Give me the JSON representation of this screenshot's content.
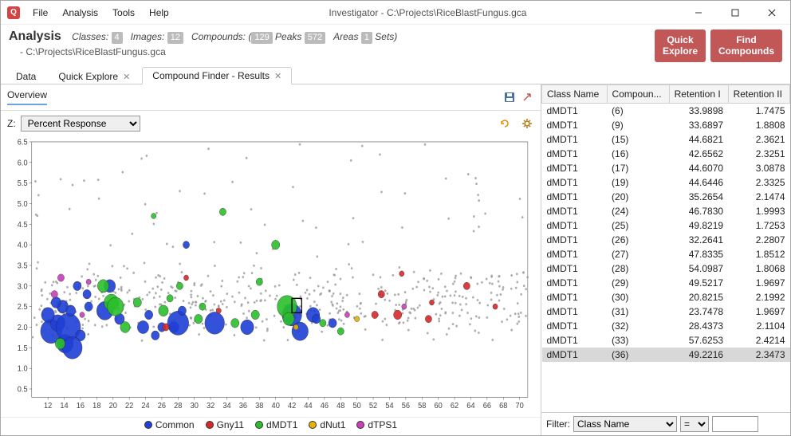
{
  "window": {
    "title": "Investigator - C:\\Projects\\RiceBlastFungus.gca"
  },
  "menu": {
    "items": [
      "File",
      "Analysis",
      "Tools",
      "Help"
    ]
  },
  "analysis": {
    "label": "Analysis",
    "stats": {
      "classes_label": "Classes:",
      "classes": "4",
      "images_label": "Images:",
      "images": "12",
      "compounds_label": "Compounds: (",
      "compounds": "129",
      "peaks_label": "Peaks",
      "peaks": "572",
      "areas_label": "Areas",
      "areas": "1",
      "sets_label": "Sets)"
    },
    "path": "- C:\\Projects\\RiceBlastFungus.gca"
  },
  "header_buttons": {
    "quick_explore": "Quick\nExplore",
    "find_compounds": "Find\nCompounds"
  },
  "tabs": {
    "data": "Data",
    "quick_explore": "Quick Explore",
    "compound_finder": "Compound Finder - Results"
  },
  "overview": {
    "title": "Overview"
  },
  "z_selector": {
    "label": "Z:",
    "options": [
      "Percent Response"
    ],
    "selected": "Percent Response"
  },
  "legend": {
    "entries": [
      {
        "name": "Common",
        "color": "#1f3fd6"
      },
      {
        "name": "Gny11",
        "color": "#d62a2a"
      },
      {
        "name": "dMDT1",
        "color": "#2bbf2b"
      },
      {
        "name": "dNut1",
        "color": "#e8b000"
      },
      {
        "name": "dTPS1",
        "color": "#c83fb8"
      }
    ]
  },
  "table": {
    "headers": [
      "Class Name",
      "Compoun...",
      "Retention I",
      "Retention II"
    ],
    "rows": [
      [
        "dMDT1",
        "(6)",
        "33.9898",
        "1.7475"
      ],
      [
        "dMDT1",
        "(9)",
        "33.6897",
        "1.8808"
      ],
      [
        "dMDT1",
        "(15)",
        "44.6821",
        "2.3621"
      ],
      [
        "dMDT1",
        "(16)",
        "42.6562",
        "2.3251"
      ],
      [
        "dMDT1",
        "(17)",
        "44.6070",
        "3.0878"
      ],
      [
        "dMDT1",
        "(19)",
        "44.6446",
        "2.3325"
      ],
      [
        "dMDT1",
        "(20)",
        "35.2654",
        "2.1474"
      ],
      [
        "dMDT1",
        "(24)",
        "46.7830",
        "1.9993"
      ],
      [
        "dMDT1",
        "(25)",
        "49.8219",
        "1.7253"
      ],
      [
        "dMDT1",
        "(26)",
        "32.2641",
        "2.2807"
      ],
      [
        "dMDT1",
        "(27)",
        "47.8335",
        "1.8512"
      ],
      [
        "dMDT1",
        "(28)",
        "54.0987",
        "1.8068"
      ],
      [
        "dMDT1",
        "(29)",
        "49.5217",
        "1.9697"
      ],
      [
        "dMDT1",
        "(30)",
        "20.8215",
        "2.1992"
      ],
      [
        "dMDT1",
        "(31)",
        "23.7478",
        "1.9697"
      ],
      [
        "dMDT1",
        "(32)",
        "28.4373",
        "2.1104"
      ],
      [
        "dMDT1",
        "(33)",
        "57.6253",
        "2.4214"
      ],
      [
        "dMDT1",
        "(36)",
        "49.2216",
        "2.3473"
      ]
    ],
    "selected_index": 17
  },
  "filter": {
    "label": "Filter:",
    "field_options": [
      "Class Name"
    ],
    "field_selected": "Class Name",
    "op_options": [
      "="
    ],
    "op_selected": "=",
    "value": ""
  },
  "chart_data": {
    "type": "scatter",
    "xlim": [
      10,
      71
    ],
    "ylim": [
      0.3,
      6.5
    ],
    "xticks": [
      12,
      14,
      16,
      18,
      20,
      22,
      24,
      26,
      28,
      30,
      32,
      34,
      36,
      38,
      40,
      42,
      44,
      46,
      48,
      50,
      52,
      54,
      56,
      58,
      60,
      62,
      64,
      66,
      68,
      70
    ],
    "yticks": [
      0.5,
      1.0,
      1.5,
      2.0,
      2.5,
      3.0,
      3.5,
      4.0,
      4.5,
      5.0,
      5.5,
      6.0,
      6.5
    ],
    "series": [
      {
        "name": "Common",
        "color": "#1f3fd6",
        "points": [
          {
            "x": 12.4,
            "y": 1.9,
            "r": 13
          },
          {
            "x": 13.2,
            "y": 2.1,
            "r": 9
          },
          {
            "x": 13.8,
            "y": 2.5,
            "r": 7
          },
          {
            "x": 14.1,
            "y": 1.6,
            "r": 10
          },
          {
            "x": 14.5,
            "y": 2.0,
            "r": 15
          },
          {
            "x": 14.8,
            "y": 2.4,
            "r": 6
          },
          {
            "x": 15.6,
            "y": 3.0,
            "r": 5
          },
          {
            "x": 16.0,
            "y": 1.8,
            "r": 6
          },
          {
            "x": 17.0,
            "y": 2.5,
            "r": 5
          },
          {
            "x": 19.0,
            "y": 2.4,
            "r": 10
          },
          {
            "x": 19.6,
            "y": 3.0,
            "r": 7
          },
          {
            "x": 20.8,
            "y": 2.2,
            "r": 6
          },
          {
            "x": 23.7,
            "y": 2.0,
            "r": 7
          },
          {
            "x": 24.4,
            "y": 2.3,
            "r": 5
          },
          {
            "x": 25.2,
            "y": 1.8,
            "r": 5
          },
          {
            "x": 26.0,
            "y": 2.0,
            "r": 5
          },
          {
            "x": 27.5,
            "y": 2.0,
            "r": 6
          },
          {
            "x": 28.0,
            "y": 2.1,
            "r": 13
          },
          {
            "x": 28.5,
            "y": 2.4,
            "r": 5
          },
          {
            "x": 32.5,
            "y": 2.1,
            "r": 12
          },
          {
            "x": 36.5,
            "y": 2.0,
            "r": 8
          },
          {
            "x": 42.0,
            "y": 2.3,
            "r": 12
          },
          {
            "x": 43.0,
            "y": 1.9,
            "r": 10
          },
          {
            "x": 44.6,
            "y": 2.3,
            "r": 8
          },
          {
            "x": 45.0,
            "y": 2.2,
            "r": 5
          },
          {
            "x": 47.0,
            "y": 2.1,
            "r": 5
          },
          {
            "x": 29.0,
            "y": 4.0,
            "r": 4
          },
          {
            "x": 16.8,
            "y": 2.8,
            "r": 5
          },
          {
            "x": 13.0,
            "y": 2.6,
            "r": 6
          },
          {
            "x": 15.0,
            "y": 1.5,
            "r": 12
          },
          {
            "x": 12.0,
            "y": 2.3,
            "r": 8
          }
        ]
      },
      {
        "name": "Gny11",
        "color": "#d62a2a",
        "points": [
          {
            "x": 26.5,
            "y": 2.0,
            "r": 4
          },
          {
            "x": 29.0,
            "y": 3.2,
            "r": 3
          },
          {
            "x": 33.0,
            "y": 2.4,
            "r": 3
          },
          {
            "x": 52.2,
            "y": 2.3,
            "r": 4
          },
          {
            "x": 53.0,
            "y": 2.8,
            "r": 4
          },
          {
            "x": 55.0,
            "y": 2.3,
            "r": 5
          },
          {
            "x": 55.5,
            "y": 3.3,
            "r": 3
          },
          {
            "x": 58.8,
            "y": 2.2,
            "r": 4
          },
          {
            "x": 59.2,
            "y": 2.6,
            "r": 3
          },
          {
            "x": 63.5,
            "y": 3.0,
            "r": 4
          },
          {
            "x": 67.0,
            "y": 2.5,
            "r": 3
          }
        ]
      },
      {
        "name": "dMDT1",
        "color": "#2bbf2b",
        "points": [
          {
            "x": 19.8,
            "y": 2.6,
            "r": 9
          },
          {
            "x": 20.3,
            "y": 2.5,
            "r": 10
          },
          {
            "x": 21.5,
            "y": 2.0,
            "r": 6
          },
          {
            "x": 23.0,
            "y": 2.6,
            "r": 5
          },
          {
            "x": 26.2,
            "y": 2.4,
            "r": 6
          },
          {
            "x": 27.0,
            "y": 2.7,
            "r": 4
          },
          {
            "x": 28.2,
            "y": 3.0,
            "r": 4
          },
          {
            "x": 30.5,
            "y": 2.2,
            "r": 5
          },
          {
            "x": 31.0,
            "y": 2.5,
            "r": 4
          },
          {
            "x": 33.5,
            "y": 4.8,
            "r": 4
          },
          {
            "x": 35.0,
            "y": 2.1,
            "r": 5
          },
          {
            "x": 37.5,
            "y": 2.3,
            "r": 5
          },
          {
            "x": 38.0,
            "y": 3.1,
            "r": 4
          },
          {
            "x": 40.0,
            "y": 4.0,
            "r": 5
          },
          {
            "x": 41.4,
            "y": 2.5,
            "r": 12
          },
          {
            "x": 41.6,
            "y": 2.2,
            "r": 7
          },
          {
            "x": 18.8,
            "y": 3.0,
            "r": 7
          },
          {
            "x": 25.0,
            "y": 4.7,
            "r": 3
          },
          {
            "x": 45.8,
            "y": 2.1,
            "r": 4
          },
          {
            "x": 48.0,
            "y": 1.9,
            "r": 4
          },
          {
            "x": 13.5,
            "y": 1.6,
            "r": 6
          }
        ]
      },
      {
        "name": "dNut1",
        "color": "#e8b000",
        "points": [
          {
            "x": 42.5,
            "y": 2.0,
            "r": 3
          },
          {
            "x": 50.0,
            "y": 2.2,
            "r": 3
          }
        ]
      },
      {
        "name": "dTPS1",
        "color": "#c83fb8",
        "points": [
          {
            "x": 12.8,
            "y": 2.8,
            "r": 4
          },
          {
            "x": 13.6,
            "y": 3.2,
            "r": 4
          },
          {
            "x": 17.0,
            "y": 3.1,
            "r": 3
          },
          {
            "x": 16.2,
            "y": 2.3,
            "r": 3
          },
          {
            "x": 48.8,
            "y": 2.3,
            "r": 3
          },
          {
            "x": 55.8,
            "y": 2.5,
            "r": 3
          }
        ]
      }
    ],
    "highlight": {
      "x": 42.0,
      "y": 2.35,
      "w": 1.2,
      "h": 0.35
    }
  }
}
